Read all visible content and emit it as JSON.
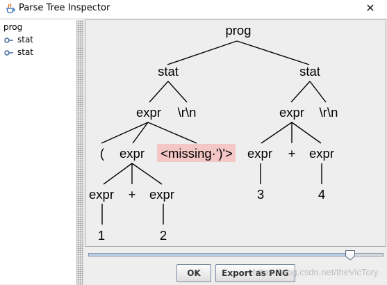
{
  "window": {
    "title": "Parse Tree Inspector",
    "close_glyph": "✕"
  },
  "tree_panel": {
    "root": "prog",
    "children": [
      {
        "label": "stat"
      },
      {
        "label": "stat"
      }
    ]
  },
  "parse_tree": {
    "nodes": {
      "prog": "prog",
      "stat1": "stat",
      "stat2": "stat",
      "expr1": "expr",
      "crlf1": "\\r\\n",
      "expr2": "expr",
      "crlf2": "\\r\\n",
      "lparen": "(",
      "expr_inner": "expr",
      "missing": "<missing·')'>",
      "expr_a": "expr",
      "plus_inner": "+",
      "expr_b": "expr",
      "one": "1",
      "two": "2",
      "expr_r1": "expr",
      "plus_r": "+",
      "expr_r2": "expr",
      "three": "3",
      "four": "4"
    },
    "error_highlight_color": "#f4c7c7"
  },
  "zoom_slider": {
    "value_fraction": 0.89
  },
  "buttons": {
    "ok": "OK",
    "export": "Export as PNG"
  },
  "watermark": "https://blog.csdn.net/theVicTory",
  "icons": {
    "app": "java-cup-icon",
    "tree_node": "tree-node-icon",
    "close": "close-icon",
    "slider_thumb": "slider-thumb"
  }
}
